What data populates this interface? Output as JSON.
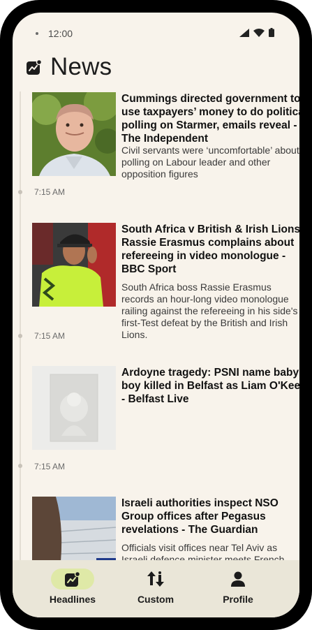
{
  "status": {
    "time": "12:00"
  },
  "header": {
    "title": "News"
  },
  "articles": [
    {
      "headline": "Cummings directed government to use taxpayers’ money to do political polling on Starmer, emails reveal - The Independent",
      "summary": "Civil servants were ‘uncomfortable’ about polling on Labour leader and other opposition figures",
      "time": "7:15 AM"
    },
    {
      "headline": "South Africa v British & Irish Lions: Rassie Erasmus complains about refereeing in video monologue - BBC Sport",
      "summary": "South Africa boss Rassie Erasmus records an hour-long video monologue railing against the refereeing in his side's first-Test defeat by the British and Irish Lions.",
      "time": "7:15 AM"
    },
    {
      "headline": "Ardoyne tragedy: PSNI name baby boy killed in Belfast as Liam O'Keefe - Belfast Live",
      "summary": "",
      "time": "7:15 AM"
    },
    {
      "headline": "Israeli authorities inspect NSO Group offices after Pegasus revelations - The Guardian",
      "summary": "Officials visit offices near Tel Aviv as Israeli defence minister meets French",
      "time": ""
    }
  ],
  "nav": {
    "items": [
      {
        "label": "Headlines",
        "icon": "trending-icon",
        "active": true
      },
      {
        "label": "Custom",
        "icon": "sort-arrows-icon",
        "active": false
      },
      {
        "label": "Profile",
        "icon": "person-icon",
        "active": false
      }
    ]
  },
  "colors": {
    "background": "#f8f3eb",
    "nav_background": "#eae6d8",
    "active_pill": "#dfe9a7"
  }
}
